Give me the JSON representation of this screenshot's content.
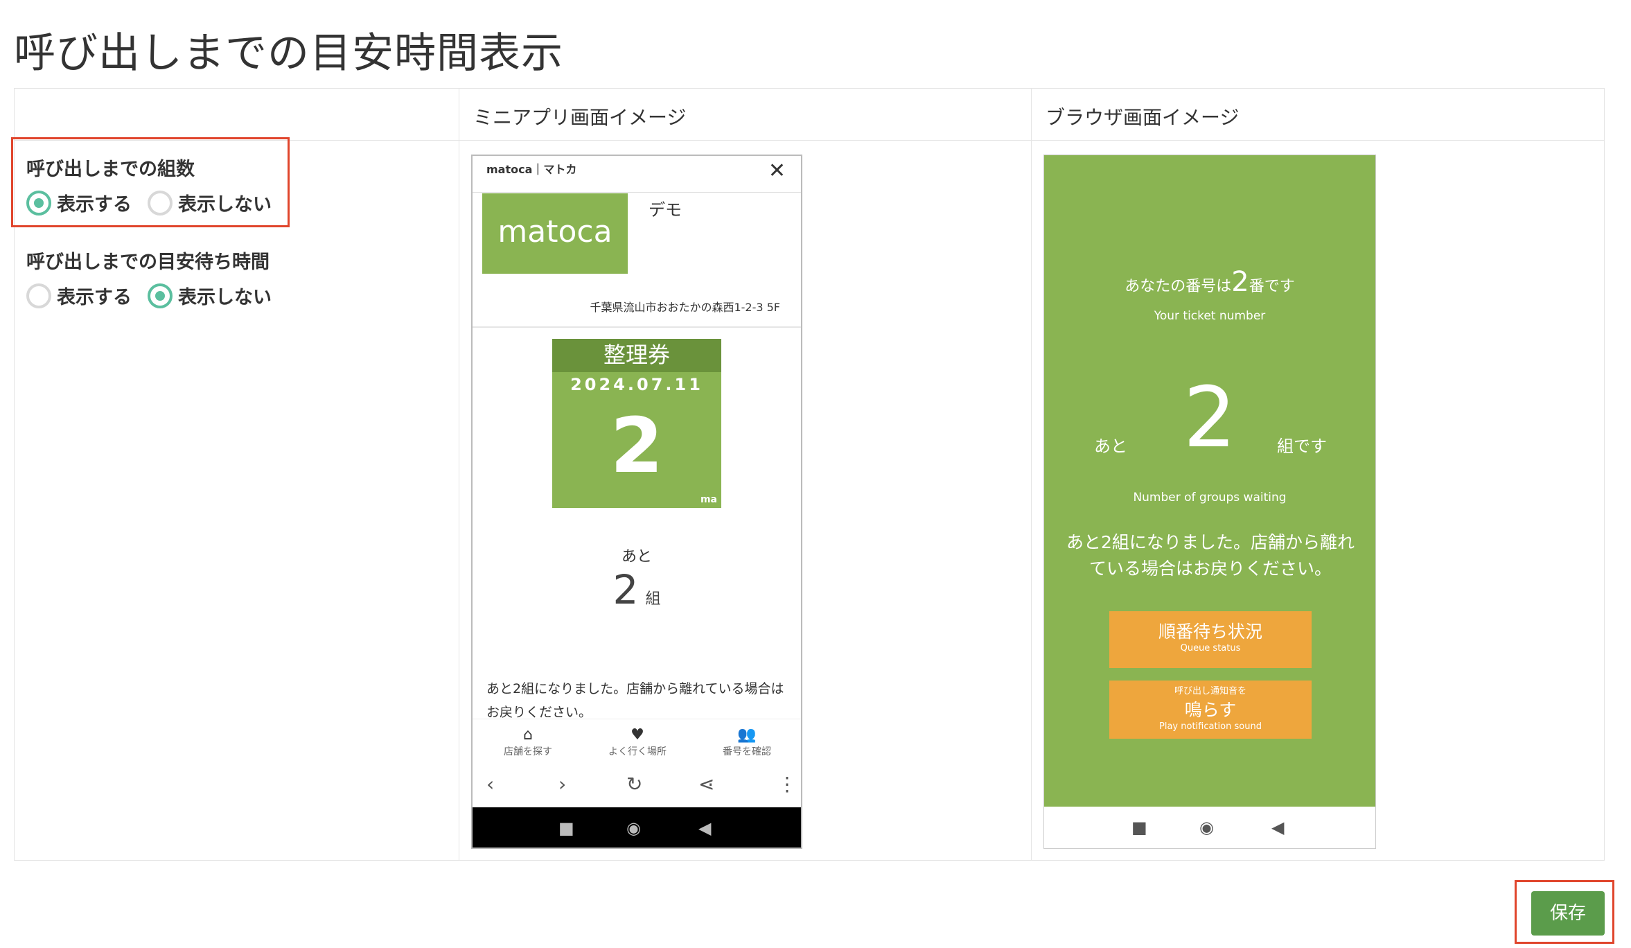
{
  "page": {
    "title": "呼び出しまでの目安時間表示"
  },
  "table": {
    "col_miniapp": "ミニアプリ画面イメージ",
    "col_browser": "ブラウザ画面イメージ"
  },
  "options": [
    {
      "title": "呼び出しまでの組数",
      "show_label": "表示する",
      "hide_label": "表示しない",
      "selected": "表示する"
    },
    {
      "title": "呼び出しまでの目安待ち時間",
      "show_label": "表示する",
      "hide_label": "表示しない",
      "selected": "表示しない"
    }
  ],
  "miniapp": {
    "brand": "matoca｜マトカ",
    "close": "✕",
    "logo_text": "matoca",
    "shop_name": "デモ",
    "address": "千葉県流山市おおたかの森西1-2-3 5F",
    "ticket_title": "整理券",
    "ticket_date": "2024.07.11",
    "ticket_number": "2",
    "ticket_mark": "ma",
    "ato": "あと",
    "groups": "2",
    "groups_unit": "組",
    "message": "あと2組になりました。店舗から離れている場合はお戻りください。",
    "nav": [
      {
        "icon": "⌂",
        "label": "店舗を探す"
      },
      {
        "icon": "♥",
        "label": "よく行く場所"
      },
      {
        "icon": "👥",
        "label": "番号を確認"
      }
    ],
    "bar": {
      "back": "‹",
      "forward": "›",
      "reload": "↻",
      "share": "⋖",
      "more": "⋮"
    },
    "sys": {
      "square": "■",
      "circle": "◉",
      "back": "◀"
    }
  },
  "browser": {
    "your_number_pre": "あなたの番号は",
    "your_number": "2",
    "your_number_post": "番です",
    "your_ticket_en": "Your ticket number",
    "ato": "あと",
    "groups": "2",
    "kumi": "組です",
    "groups_en": "Number of groups waiting",
    "message": "あと2組になりました。店舗から離れている場合はお戻りください。",
    "btn1_main": "順番待ち状況",
    "btn1_sub": "Queue status",
    "btn2_pre": "呼び出し通知音を",
    "btn2_main": "鳴らす",
    "btn2_sub": "Play notification sound",
    "sys": {
      "square": "■",
      "circle": "◉",
      "back": "◀"
    }
  },
  "actions": {
    "save": "保存"
  },
  "colors": {
    "accent": "#5bbf9f",
    "highlight": "#e0452c",
    "green": "#8ab452",
    "save": "#5b9c4b",
    "orange": "#eea63d"
  }
}
